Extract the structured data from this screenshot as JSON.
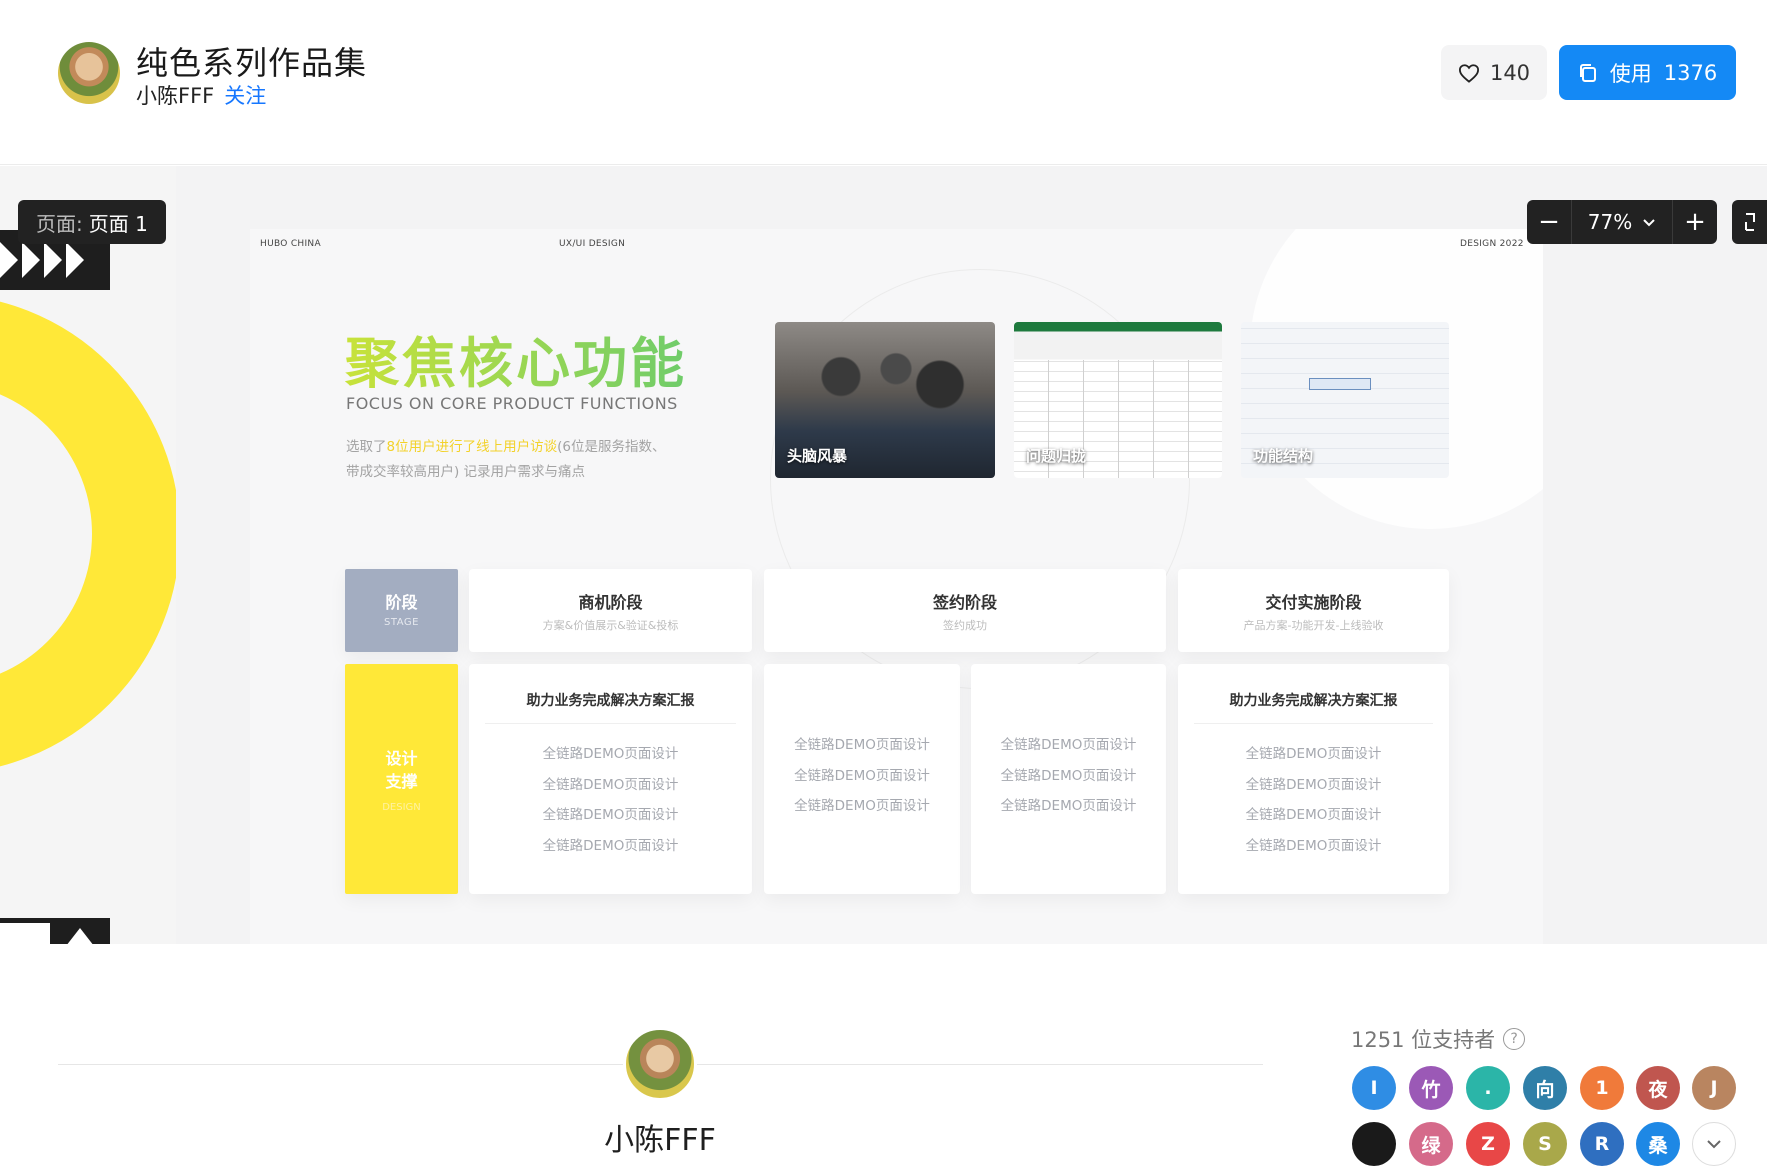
{
  "header": {
    "title": "纯色系列作品集",
    "author": "小陈FFF",
    "follow_label": "关注",
    "like_count": "140",
    "use_label": "使用",
    "use_count": "1376"
  },
  "viewer": {
    "page_label_prefix": "页面:",
    "page_name": "页面 1",
    "zoom_level": "77%",
    "zoom_out": "−",
    "zoom_in": "+"
  },
  "slide": {
    "brand": "HUBO CHINA",
    "category": "UX/UI DESIGN",
    "year": "DESIGN 2022",
    "title": "聚焦核心功能",
    "subtitle": "FOCUS ON CORE PRODUCT FUNCTIONS",
    "desc_before": "选取了",
    "desc_highlight": "8位用户进行了线上用户访谈",
    "desc_after": "(6位是服务指数、带成交率较高用户) 记录用户需求与痛点",
    "photos": [
      {
        "caption": "头脑风暴"
      },
      {
        "caption": "问题归拢"
      },
      {
        "caption": "功能结构"
      }
    ],
    "stage_header": {
      "title": "阶段",
      "en": "STAGE"
    },
    "columns": [
      {
        "title": "商机阶段",
        "sub": "方案&价值展示&验证&投标"
      },
      {
        "title": "签约阶段",
        "sub": "签约成功"
      },
      {
        "title": "交付实施阶段",
        "sub": "产品方案-功能开发-上线验收"
      }
    ],
    "design_side": {
      "line1": "设计",
      "line2": "支撑",
      "en": "DESIGN"
    },
    "cards": [
      {
        "title": "助力业务完成解决方案汇报",
        "items": [
          "全链路DEMO页面设计",
          "全链路DEMO页面设计",
          "全链路DEMO页面设计",
          "全链路DEMO页面设计"
        ]
      },
      {
        "title": "",
        "items": [
          "全链路DEMO页面设计",
          "全链路DEMO页面设计",
          "全链路DEMO页面设计"
        ]
      },
      {
        "title": "",
        "items": [
          "全链路DEMO页面设计",
          "全链路DEMO页面设计",
          "全链路DEMO页面设计"
        ]
      },
      {
        "title": "助力业务完成解决方案汇报",
        "items": [
          "全链路DEMO页面设计",
          "全链路DEMO页面设计",
          "全链路DEMO页面设计",
          "全链路DEMO页面设计"
        ]
      }
    ]
  },
  "footer": {
    "author": "小陈FFF",
    "supporters_count_label": "1251 位支持者",
    "help_glyph": "?",
    "supporters": [
      {
        "letter": "I",
        "color": "#2f8de4"
      },
      {
        "letter": "竹",
        "color": "#9b59b6"
      },
      {
        "letter": ".",
        "color": "#2bb5a8"
      },
      {
        "letter": "向",
        "color": "#2f7fa8"
      },
      {
        "letter": "1",
        "color": "#f07a3a"
      },
      {
        "letter": "夜",
        "color": "#c0564f"
      },
      {
        "letter": "J",
        "color": "#b98560"
      },
      {
        "letter": "",
        "color": "#1a1a1a"
      },
      {
        "letter": "绿",
        "color": "#d56a8a"
      },
      {
        "letter": "Z",
        "color": "#e84747"
      },
      {
        "letter": "S",
        "color": "#a9a84a"
      },
      {
        "letter": "R",
        "color": "#2f6fc0"
      },
      {
        "letter": "桑",
        "color": "#1e88e5"
      }
    ]
  }
}
